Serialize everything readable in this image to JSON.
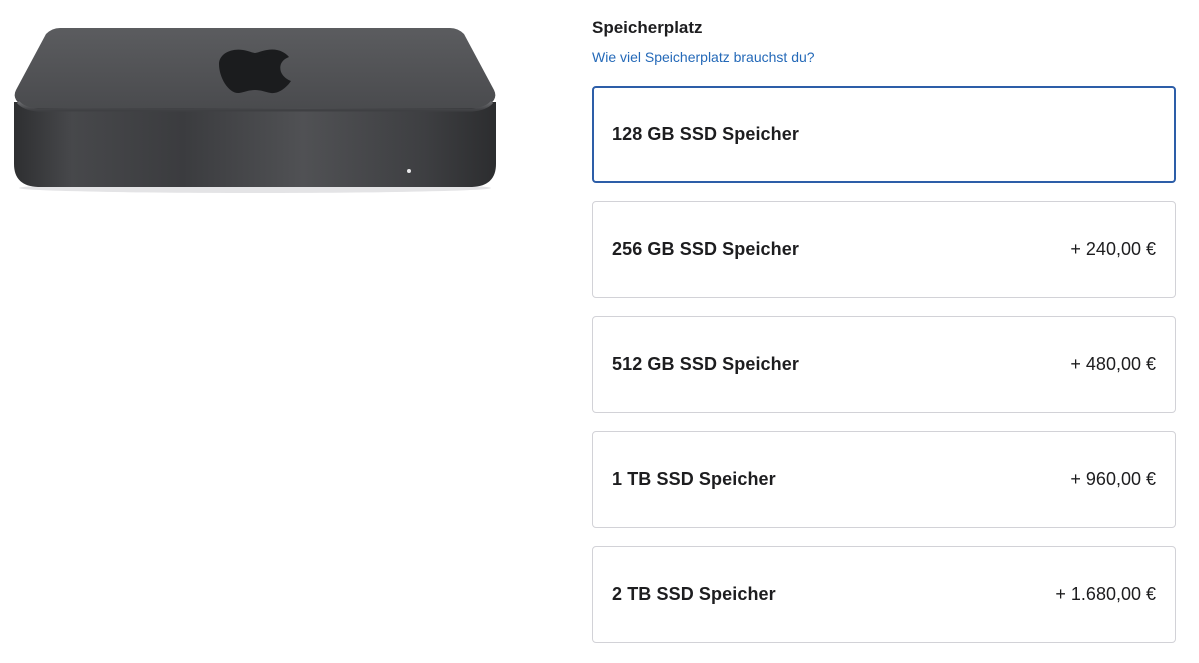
{
  "product": {
    "image_alt": "Mac mini"
  },
  "storage": {
    "title": "Speicherplatz",
    "help_link": "Wie viel Speicherplatz brauchst du?",
    "selected_index": 0,
    "options": [
      {
        "label": "128 GB SSD Speicher",
        "price": ""
      },
      {
        "label": "256 GB SSD Speicher",
        "price": "+ 240,00 €"
      },
      {
        "label": "512 GB SSD Speicher",
        "price": "+ 480,00 €"
      },
      {
        "label": "1 TB SSD Speicher",
        "price": "+ 960,00 €"
      },
      {
        "label": "2 TB SSD Speicher",
        "price": "+ 1.680,00 €"
      }
    ]
  },
  "colors": {
    "selected_border": "#2d5ea8",
    "border": "#d2d2d7",
    "link": "#2469b8",
    "device_body": "#3a3b3d"
  }
}
